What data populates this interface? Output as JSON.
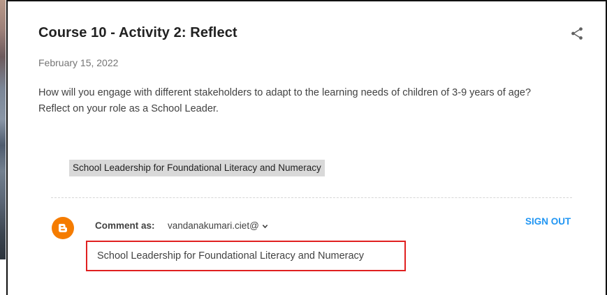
{
  "post": {
    "title": "Course 10 - Activity 2: Reflect",
    "date": "February 15, 2022",
    "body_lines": [
      "How will you engage with different stakeholders to adapt to the learning needs of children of 3-9 years of age?",
      "Reflect on your role as a School Leader."
    ],
    "highlighted_text": "School Leadership for Foundational Literacy and Numeracy"
  },
  "comment": {
    "label": "Comment as:",
    "account": "vandanakumari.ciet@",
    "sign_out": "SIGN OUT",
    "input_value": "School Leadership for Foundational Literacy and Numeracy"
  },
  "icons": {
    "share": "share-icon",
    "avatar": "blogger-avatar-icon",
    "dropdown": "chevron-down-icon"
  },
  "colors": {
    "accent": "#2196f3",
    "avatar": "#f57c00",
    "highlight_border": "#e02020"
  }
}
